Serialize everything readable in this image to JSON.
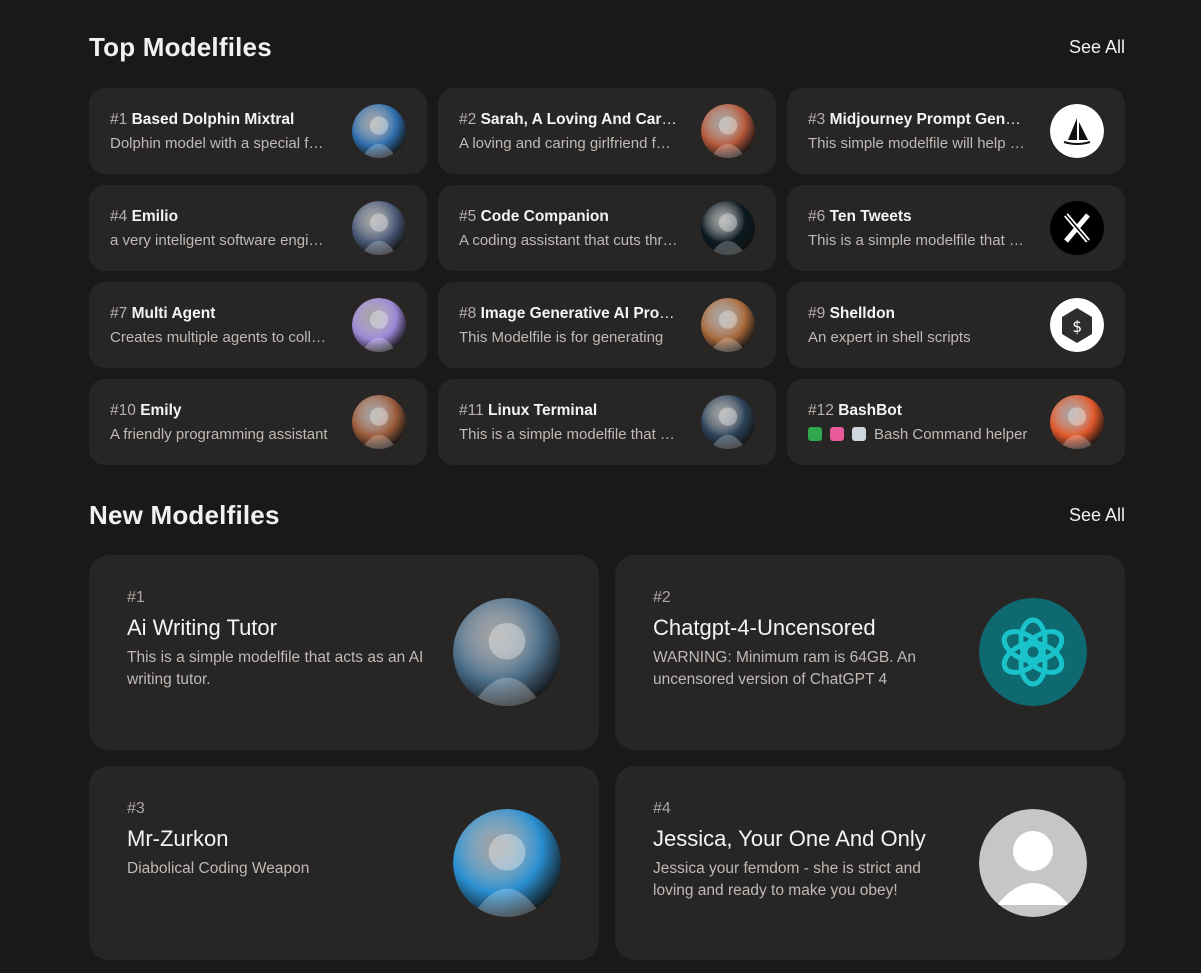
{
  "top": {
    "title": "Top Modelfiles",
    "see_all": "See All",
    "items": [
      {
        "rank": "#1",
        "name": "Based Dolphin Mixtral",
        "desc": "Dolphin model with a special focus",
        "avatar_icon": "robot-avatar-icon",
        "avatar_color": "#2f6fae"
      },
      {
        "rank": "#2",
        "name": "Sarah, A Loving And Caring Girlfriend",
        "desc": "A loving and caring girlfriend for you",
        "avatar_icon": "woman-avatar-icon",
        "avatar_color": "#b5583a"
      },
      {
        "rank": "#3",
        "name": "Midjourney Prompt Generator",
        "desc": "This simple modelfile will help you",
        "avatar_icon": "sailboat-icon",
        "avatar_color": "#ffffff"
      },
      {
        "rank": "#4",
        "name": "Emilio",
        "desc": "a very inteligent software engineer",
        "avatar_icon": "man-avatar-icon",
        "avatar_color": "#4a5a78"
      },
      {
        "rank": "#5",
        "name": "Code Companion",
        "desc": "A coding assistant that cuts through",
        "avatar_icon": "circuit-face-icon",
        "avatar_color": "#0b1a22"
      },
      {
        "rank": "#6",
        "name": "Ten Tweets",
        "desc": "This is a simple modelfile that writes",
        "avatar_icon": "x-logo-icon",
        "avatar_color": "#000000"
      },
      {
        "rank": "#7",
        "name": "Multi Agent",
        "desc": "Creates multiple agents to collaborate",
        "avatar_icon": "robot-face-icon",
        "avatar_color": "#9c87d6"
      },
      {
        "rank": "#8",
        "name": "Image Generative AI Prompt",
        "desc": "This Modelfile is for generating",
        "avatar_icon": "cactus-robot-icon",
        "avatar_color": "#a86a3c"
      },
      {
        "rank": "#9",
        "name": "Shelldon",
        "desc": "An expert in shell scripts",
        "avatar_icon": "terminal-cube-icon",
        "avatar_color": "#ffffff"
      },
      {
        "rank": "#10",
        "name": "Emily",
        "desc": "A friendly programming assistant",
        "avatar_icon": "anime-girl-icon",
        "avatar_color": "#9a5a3a"
      },
      {
        "rank": "#11",
        "name": "Linux Terminal",
        "desc": "This is a simple modelfile that acts",
        "avatar_icon": "computer-desk-icon",
        "avatar_color": "#2c4258"
      },
      {
        "rank": "#12",
        "name": "BashBot",
        "desc": "Bash Command helper",
        "emojis": [
          "#2fa84f",
          "#e85a9a",
          "#cfd6e0"
        ],
        "avatar_icon": "fire-terminal-icon",
        "avatar_color": "#e0572a"
      }
    ]
  },
  "new": {
    "title": "New Modelfiles",
    "see_all": "See All",
    "items": [
      {
        "rank": "#1",
        "name": "Ai Writing Tutor",
        "desc": "This is a simple modelfile that acts as an AI writing tutor.",
        "avatar_icon": "robot-writer-icon",
        "avatar_color": "#4b6e8a"
      },
      {
        "rank": "#2",
        "name": "Chatgpt-4-Uncensored",
        "desc": "WARNING: Minimum ram is 64GB. An uncensored version of ChatGPT 4",
        "avatar_icon": "openai-logo-icon",
        "avatar_color": "#0e6a70"
      },
      {
        "rank": "#3",
        "name": "Mr-Zurkon",
        "desc": "Diabolical Coding Weapon",
        "avatar_icon": "evil-robot-icon",
        "avatar_color": "#2a8fd0"
      },
      {
        "rank": "#4",
        "name": "Jessica, Your One And Only",
        "desc": "Jessica your femdom - she is strict and loving and ready to make you obey!",
        "avatar_icon": "default-user-icon",
        "avatar_color": "#c9c9c9"
      }
    ]
  }
}
